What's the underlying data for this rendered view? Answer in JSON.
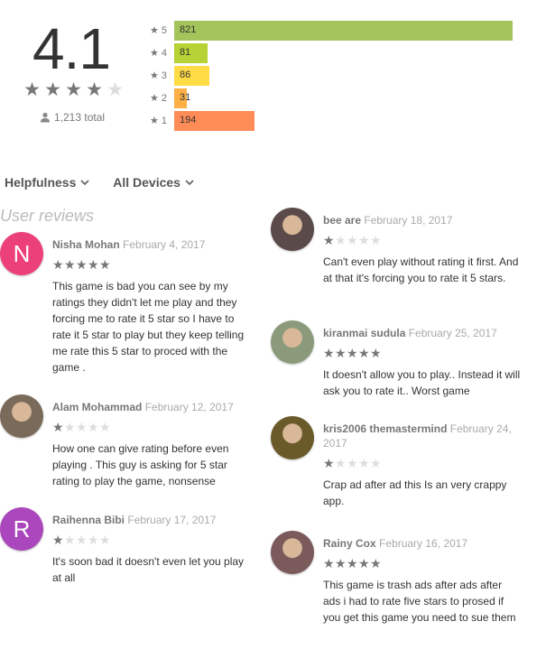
{
  "summary": {
    "score": "4.1",
    "stars": [
      true,
      true,
      true,
      true,
      false
    ],
    "total": "1,213 total",
    "histogram": [
      {
        "label": "5",
        "count": "821",
        "value": 821,
        "color": "#a3c45a"
      },
      {
        "label": "4",
        "count": "81",
        "value": 81,
        "color": "#b5d334"
      },
      {
        "label": "3",
        "count": "86",
        "value": 86,
        "color": "#ffdb45"
      },
      {
        "label": "2",
        "count": "31",
        "value": 31,
        "color": "#fdb045"
      },
      {
        "label": "1",
        "count": "194",
        "value": 194,
        "color": "#ff8c57"
      }
    ]
  },
  "filters": {
    "sort": "Helpfulness",
    "devices": "All Devices"
  },
  "heading": "User reviews",
  "colors": {
    "star_on": "#777777",
    "star_off": "#dddddd"
  },
  "reviews": [
    {
      "author": "Nisha Mohan",
      "date": "February 4, 2017",
      "rating": 5,
      "avatar_letter": "N",
      "avatar_color": "#ec407a",
      "text": "This game is bad you can see by my ratings they didn't let me play and they forcing me to rate it 5 star so I have to rate it 5 star to play but they keep telling me rate this 5 star to proced with the game ."
    },
    {
      "author": "Alam Mohammad",
      "date": "February 12, 2017",
      "rating": 1,
      "avatar_letter": "",
      "avatar_color": "#7a6a5a",
      "text": "How one can give rating before even playing . This guy is asking for 5 star rating to play the game, nonsense"
    },
    {
      "author": "Raihenna Bibi",
      "date": "February 17, 2017",
      "rating": 1,
      "avatar_letter": "R",
      "avatar_color": "#ab47bc",
      "text": "It's soon bad it doesn't even let you play at all"
    },
    {
      "author": "bee are",
      "date": "February 18, 2017",
      "rating": 1,
      "avatar_letter": "",
      "avatar_color": "#5a4a4a",
      "text": "Can't even play without rating it first. And at that it's forcing you to rate it 5 stars."
    },
    {
      "author": "kiranmai sudula",
      "date": "February 25, 2017",
      "rating": 5,
      "avatar_letter": "",
      "avatar_color": "#8a9a7a",
      "text": "It doesn't allow you to play.. Instead it will ask you to rate it.. Worst game"
    },
    {
      "author": "kris2006 themastermind",
      "date": "February 24, 2017",
      "rating": 1,
      "avatar_letter": "",
      "avatar_color": "#6a5a2a",
      "text": "Crap ad after ad this Is an very crappy app."
    },
    {
      "author": "Rainy Cox",
      "date": "February 16, 2017",
      "rating": 5,
      "avatar_letter": "",
      "avatar_color": "#7a5a5a",
      "text": "This game is trash ads after ads after ads i had to rate five stars to prosed if you get this game you need to sue them"
    }
  ]
}
